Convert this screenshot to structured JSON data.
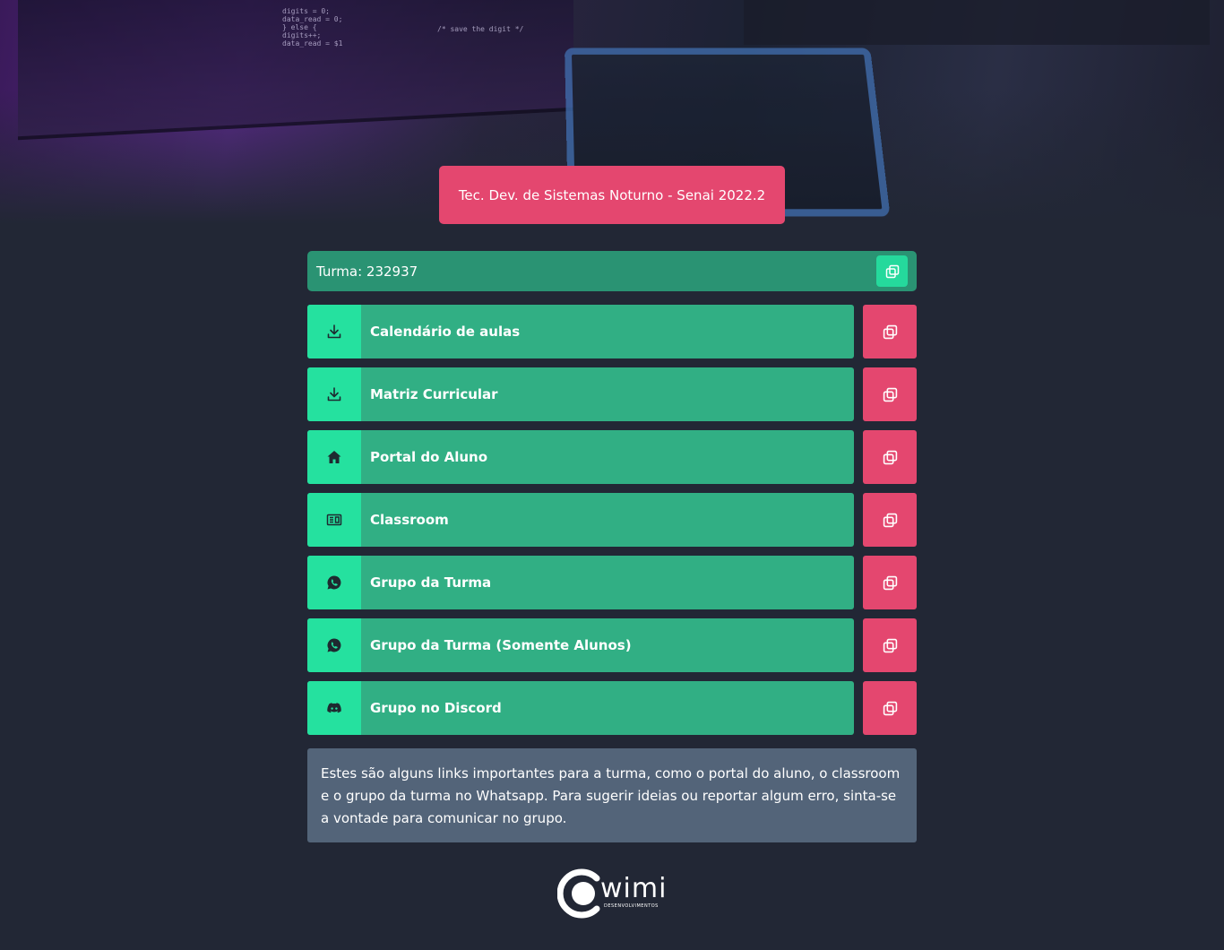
{
  "header": {
    "title": "Tec. Dev. de Sistemas Noturno - Senai 2022.2",
    "hero_code_left": "digits = 0;\ndata_read = 0;\n} else {\ndigits++;\ndata_read = $1",
    "hero_code_comment": "/* save the digit */"
  },
  "turma": {
    "label": "Turma: 232937",
    "copy_icon": "copy-icon"
  },
  "links": [
    {
      "label": "Calendário de aulas",
      "icon": "download-icon"
    },
    {
      "label": "Matriz Curricular",
      "icon": "download-icon"
    },
    {
      "label": "Portal do Aluno",
      "icon": "home-icon"
    },
    {
      "label": "Classroom",
      "icon": "classroom-icon"
    },
    {
      "label": "Grupo da Turma",
      "icon": "whatsapp-icon"
    },
    {
      "label": "Grupo da Turma (Somente Alunos)",
      "icon": "whatsapp-icon"
    },
    {
      "label": "Grupo no Discord",
      "icon": "discord-icon"
    }
  ],
  "info": {
    "text": "Estes são alguns links importantes para a turma, como o portal do aluno, o classroom e o grupo da turma no Whatsapp. Para sugerir ideias ou reportar algum erro, sinta-se a vontade para comunicar no grupo."
  },
  "footer": {
    "logo_text": "wimi",
    "logo_subtext": "DESENVOLVIMENTOS"
  },
  "colors": {
    "background": "#222735",
    "accent_pink": "#e4476f",
    "accent_green": "#31af84",
    "icon_green": "#25e19f",
    "info_bg": "#536479"
  }
}
